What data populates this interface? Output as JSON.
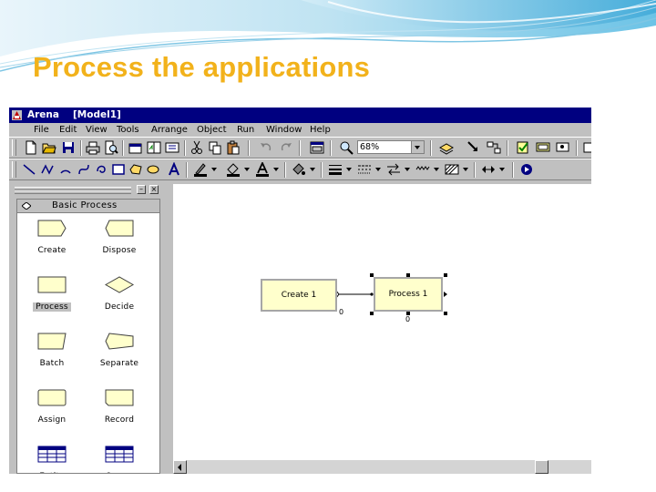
{
  "slide": {
    "title": "Process the applications"
  },
  "window": {
    "app_name": "Arena",
    "doc_name": "[Model1]"
  },
  "menu": [
    "File",
    "Edit",
    "View",
    "Tools",
    "Arrange",
    "Object",
    "Run",
    "Window",
    "Help"
  ],
  "toolbar": {
    "zoom_value": "68%"
  },
  "panel": {
    "title": "Basic Process",
    "modules": [
      {
        "label": "Create",
        "shape": "create"
      },
      {
        "label": "Dispose",
        "shape": "dispose"
      },
      {
        "label": "Process",
        "shape": "process",
        "selected": true
      },
      {
        "label": "Decide",
        "shape": "decide"
      },
      {
        "label": "Batch",
        "shape": "batch"
      },
      {
        "label": "Separate",
        "shape": "separate"
      },
      {
        "label": "Assign",
        "shape": "assign"
      },
      {
        "label": "Record",
        "shape": "record"
      },
      {
        "label": "Entity",
        "shape": "spreadsheet"
      },
      {
        "label": "Queue",
        "shape": "spreadsheet"
      }
    ]
  },
  "model": {
    "create_block": {
      "label": "Create 1",
      "counter": "0"
    },
    "process_block": {
      "label": "Process 1",
      "counter": "0"
    }
  },
  "colors": {
    "slide_title": "#f2b21b",
    "title_bar": "#000080",
    "module_fill": "#ffffcc"
  }
}
